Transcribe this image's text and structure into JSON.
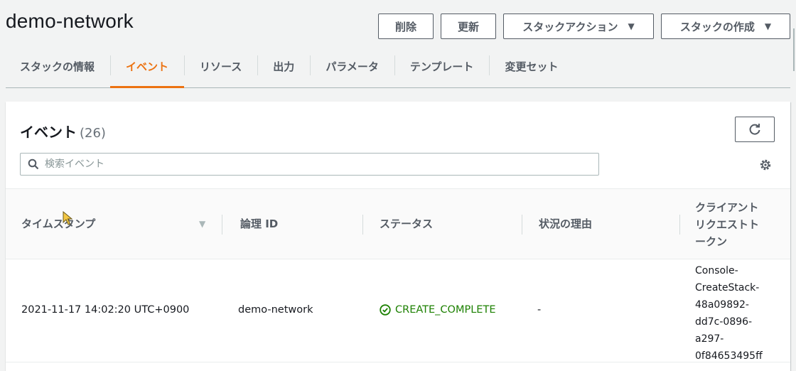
{
  "header": {
    "title": "demo-network",
    "buttons": {
      "delete": "削除",
      "update": "更新",
      "stack_actions": "スタックアクション",
      "create_stack": "スタックの作成"
    }
  },
  "tabs": [
    {
      "label": "スタックの情報"
    },
    {
      "label": "イベント",
      "active": true
    },
    {
      "label": "リソース"
    },
    {
      "label": "出力"
    },
    {
      "label": "パラメータ"
    },
    {
      "label": "テンプレート"
    },
    {
      "label": "変更セット"
    }
  ],
  "events": {
    "title": "イベント",
    "count": "(26)",
    "search_placeholder": "検索イベント",
    "columns": {
      "timestamp": "タイムスタンプ",
      "logical_id": "論理 ID",
      "status": "ステータス",
      "status_reason": "状況の理由",
      "client_token_1": "クライアント",
      "client_token_2": "リクエストト",
      "client_token_3": "ークン"
    },
    "rows": [
      {
        "timestamp": "2021-11-17 14:02:20 UTC+0900",
        "logical_id": "demo-network",
        "status": "CREATE_COMPLETE",
        "status_reason": "-",
        "token_lines": [
          "Console-",
          "CreateStack-",
          "48a09892-",
          "dd7c-0896-",
          "a297-",
          "0f84653495ff"
        ]
      }
    ]
  },
  "colors": {
    "accent": "#ec7211",
    "success": "#1d8102",
    "text": "#16191f",
    "muted": "#545b64"
  }
}
